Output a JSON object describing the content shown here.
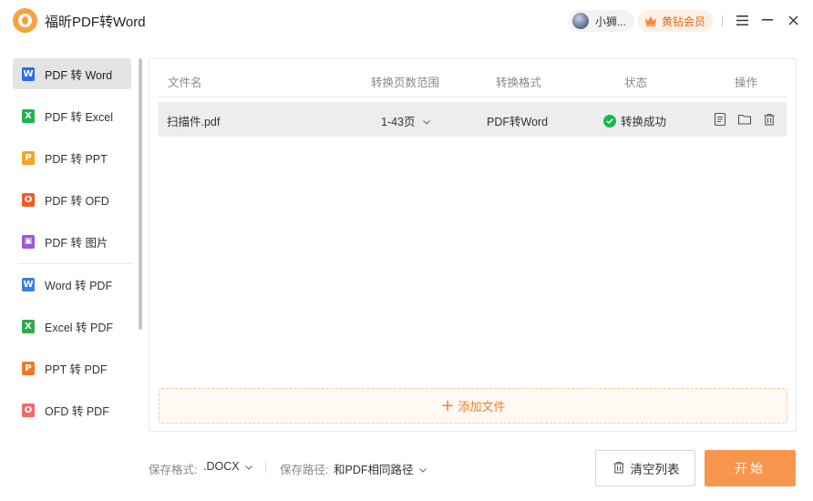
{
  "titlebar": {
    "app_title": "福昕PDF转Word",
    "username": "小狮...",
    "vip_label": "黄钻会员"
  },
  "sidebar": {
    "items": [
      {
        "label": "PDF 转 Word",
        "icon": "W",
        "color": "#2b6ce8",
        "active": true
      },
      {
        "label": "PDF 转 Excel",
        "icon": "X",
        "color": "#1fb24a"
      },
      {
        "label": "PDF 转 PPT",
        "icon": "P",
        "color": "#f5a623"
      },
      {
        "label": "PDF 转 OFD",
        "icon": "O",
        "color": "#f25c24"
      },
      {
        "label": "PDF 转 图片",
        "icon": "▣",
        "color": "#9b59d6"
      },
      {
        "label": "Word 转 PDF",
        "icon": "W",
        "color": "#3d7de8"
      },
      {
        "label": "Excel 转 PDF",
        "icon": "X",
        "color": "#2eaa4a"
      },
      {
        "label": "PPT 转 PDF",
        "icon": "P",
        "color": "#f07a24"
      },
      {
        "label": "OFD 转 PDF",
        "icon": "O",
        "color": "#f06a6a"
      }
    ]
  },
  "table": {
    "headers": {
      "name": "文件名",
      "range": "转换页数范围",
      "format": "转换格式",
      "status": "状态",
      "ops": "操作"
    },
    "rows": [
      {
        "name": "扫描件.pdf",
        "range": "1-43页",
        "format": "PDF转Word",
        "status": "转换成功"
      }
    ]
  },
  "add_file_label": "添加文件",
  "bottom": {
    "format_label": "保存格式:",
    "format_value": ".DOCX",
    "path_label": "保存路径:",
    "path_value": "和PDF相同路径",
    "clear_label": "清空列表",
    "start_label": "开始"
  },
  "colors": {
    "accent": "#f9964d",
    "success": "#1ab84a",
    "vip": "#e06a1b"
  }
}
